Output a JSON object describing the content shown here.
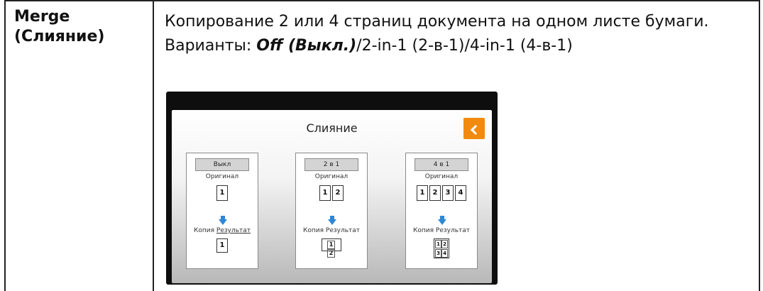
{
  "term": {
    "line1": "Merge",
    "line2": "(Слияние)"
  },
  "description": {
    "text_before": "Копирование 2 или 4 страниц документа на одном листе бумаги. Варианты: ",
    "emphasis": "Off (Выкл.)",
    "text_after": "/2-in-1 (2-в-1)/4-in-1 (4-в-1)"
  },
  "screen": {
    "title": "Слияние",
    "back_button": "<",
    "original_label": "Оригинал",
    "copy_label": "Копия",
    "result_label": "Результат",
    "options": [
      {
        "label": "Выкл",
        "original_pages": [
          "1"
        ],
        "result_pages": [
          "1"
        ]
      },
      {
        "label": "2 в 1",
        "original_pages": [
          "1",
          "2"
        ],
        "result_pages": [
          "1",
          "2"
        ]
      },
      {
        "label": "4 в 1",
        "original_pages": [
          "1",
          "2",
          "3",
          "4"
        ],
        "result_pages": [
          "1",
          "2",
          "3",
          "4"
        ]
      }
    ]
  },
  "colors": {
    "accent": "#f28a10",
    "arrow": "#2f86d4"
  }
}
